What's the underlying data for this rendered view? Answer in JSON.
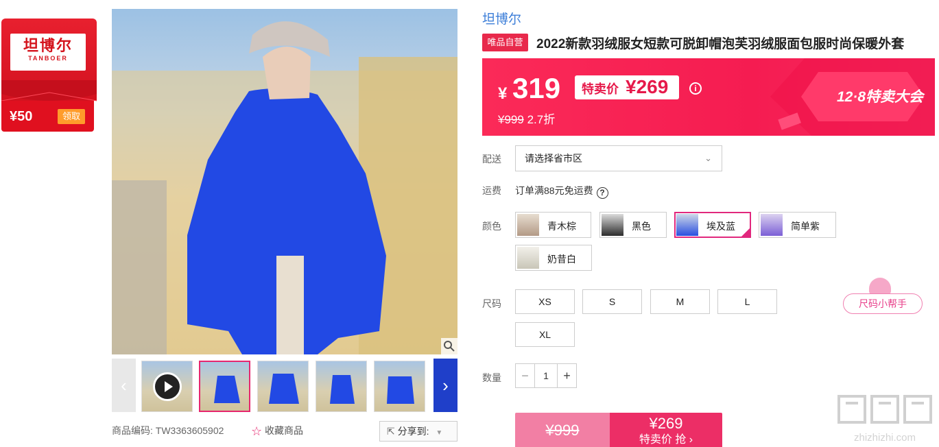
{
  "coupon": {
    "brand_cn": "坦博尔",
    "brand_en": "TANBOER",
    "amount": "¥50",
    "claim_label": "领取"
  },
  "gallery": {
    "thumbnails": [
      "video",
      "image-2",
      "image-3",
      "image-4",
      "image-5"
    ],
    "active_index": 1
  },
  "meta": {
    "product_code_label": "商品编码:",
    "product_code": "TW3363605902",
    "favorite_label": "收藏商品",
    "share_label": "分享到:"
  },
  "product": {
    "brand": "坦博尔",
    "self_run_tag": "唯品自营",
    "title": "2022新款羽绒服女短款可脱卸帽泡芙羽绒服面包服时尚保暖外套"
  },
  "price": {
    "currency": "¥",
    "current": "319",
    "special_label": "特卖价",
    "special_price": "¥269",
    "original": "¥999",
    "discount": "2.7折",
    "promo": "12·8特卖大会"
  },
  "delivery": {
    "label": "配送",
    "placeholder": "请选择省市区"
  },
  "shipping": {
    "label": "运费",
    "text": "订单满88元免运费"
  },
  "colors": {
    "label": "颜色",
    "options": [
      "青木棕",
      "黑色",
      "埃及蓝",
      "简单紫",
      "奶昔白"
    ],
    "selected": "埃及蓝",
    "swatch_colors": [
      "#b39a86",
      "#2c2c2c",
      "#2a4fe0",
      "#7b5fd6",
      "#e6e4dc"
    ]
  },
  "sizes": {
    "label": "尺码",
    "options": [
      "XS",
      "S",
      "M",
      "L",
      "XL"
    ],
    "helper": "尺码小帮手"
  },
  "quantity": {
    "label": "数量",
    "value": "1",
    "minus": "−",
    "plus": "+"
  },
  "buy": {
    "original_price": "¥999",
    "special_price": "¥269",
    "special_action": "特卖价 抢 ›"
  },
  "watermark": {
    "site": "zhizhizhi.com"
  },
  "colors_theme": {
    "accent": "#e6266e",
    "brand_red": "#d4141d",
    "link_blue": "#3c7ed8"
  }
}
